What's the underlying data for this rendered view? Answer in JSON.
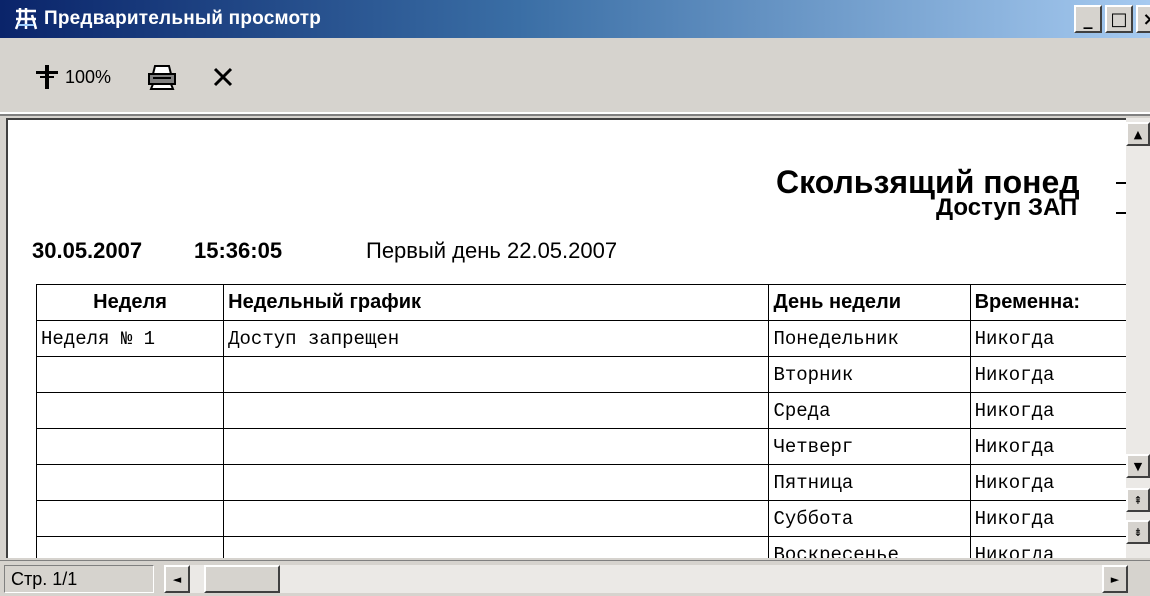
{
  "window": {
    "title": "Предварительный просмотр",
    "minimize_label": "_",
    "maximize_label": "□",
    "close_label": "×"
  },
  "toolbar": {
    "zoom_label": "100%"
  },
  "report": {
    "title": "Скользящий понед",
    "subtitle": "Доступ ЗАП",
    "date": "30.05.2007",
    "time": "15:36:05",
    "first_day": "Первый день 22.05.2007",
    "columns": [
      "Неделя",
      "Недельный график",
      "День недели",
      "Временна:"
    ],
    "rows": [
      [
        "Неделя № 1",
        "Доступ запрещен",
        "Понедельник",
        "Никогда"
      ],
      [
        "",
        "",
        "Вторник",
        "Никогда"
      ],
      [
        "",
        "",
        "Среда",
        "Никогда"
      ],
      [
        "",
        "",
        "Четверг",
        "Никогда"
      ],
      [
        "",
        "",
        "Пятница",
        "Никогда"
      ],
      [
        "",
        "",
        "Суббота",
        "Никогда"
      ],
      [
        "",
        "",
        "Воскресенье",
        "Никогда"
      ]
    ]
  },
  "status": {
    "page": "Стр. 1/1"
  }
}
